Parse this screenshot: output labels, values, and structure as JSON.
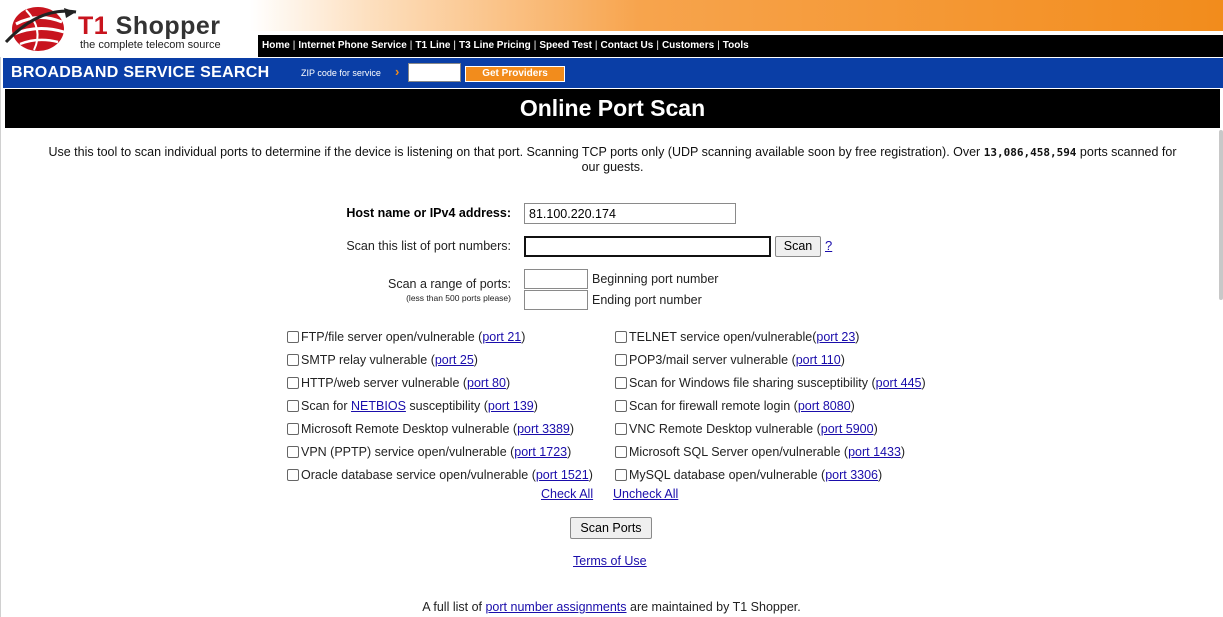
{
  "brand": {
    "name_prefix": "T1",
    "name_suffix": "Shopper",
    "tagline": "the complete telecom source"
  },
  "nav": [
    "Home",
    "Internet Phone Service",
    "T1 Line",
    "T3 Line Pricing",
    "Speed Test",
    "Contact Us",
    "Customers",
    "Tools"
  ],
  "broadband": {
    "title": "BROADBAND SERVICE SEARCH",
    "zip_label": "ZIP code for service",
    "arrow": "›",
    "zip_value": "",
    "button": "Get Providers"
  },
  "page_title": "Online Port Scan",
  "intro": {
    "text_before": "Use this tool to scan individual ports to determine if the device is listening on that port.  Scanning TCP ports only (UDP scanning available soon by free registration).  Over",
    "count": "13,086,458,594",
    "text_after": "ports scanned for our guests."
  },
  "form": {
    "host_label": "Host name or IPv4 address:",
    "host_value": "81.100.220.174",
    "list_label": "Scan this list of port numbers:",
    "list_value": "",
    "scan_button": "Scan",
    "help_link": "?",
    "range_label": "Scan a range of ports:",
    "range_note": "(less than 500 ports please)",
    "begin_value": "",
    "begin_label": "Beginning port number",
    "end_value": "",
    "end_label": "Ending port number"
  },
  "checks_left": [
    {
      "pre": "",
      "mid_link": "",
      "text": "FTP/file server open/vulnerable (",
      "port": "port 21",
      "post": ")"
    },
    {
      "pre": "",
      "mid_link": "",
      "text": "SMTP relay vulnerable (",
      "port": "port 25",
      "post": ")"
    },
    {
      "pre": "",
      "mid_link": "",
      "text": "HTTP/web server vulnerable (",
      "port": "port 80",
      "post": ")"
    },
    {
      "pre": "Scan for ",
      "mid_link": "NETBIOS",
      "text": " susceptibility (",
      "port": "port 139",
      "post": ")"
    },
    {
      "pre": "",
      "mid_link": "",
      "text": "Microsoft Remote Desktop vulnerable (",
      "port": "port 3389",
      "post": ")"
    },
    {
      "pre": "",
      "mid_link": "",
      "text": "VPN (PPTP) service open/vulnerable (",
      "port": "port 1723",
      "post": ")"
    },
    {
      "pre": "",
      "mid_link": "",
      "text": "Oracle database service open/vulnerable (",
      "port": "port 1521",
      "post": ")"
    }
  ],
  "checks_right": [
    {
      "text": "TELNET service open/vulnerable(",
      "port": "port 23",
      "post": ")"
    },
    {
      "text": "POP3/mail server vulnerable (",
      "port": "port 110",
      "post": ")"
    },
    {
      "text": "Scan for Windows file sharing susceptibility (",
      "port": "port 445",
      "post": ")"
    },
    {
      "text": "Scan for firewall remote login (",
      "port": "port 8080",
      "post": ")"
    },
    {
      "text": "VNC Remote Desktop vulnerable (",
      "port": "port 5900",
      "post": ")"
    },
    {
      "text": "Microsoft SQL Server open/vulnerable (",
      "port": "port 1433",
      "post": ")"
    },
    {
      "text": "MySQL database open/vulnerable (",
      "port": "port 3306",
      "post": ")"
    }
  ],
  "check_all": "Check All",
  "uncheck_all": "Uncheck All",
  "scan_ports_button": "Scan Ports",
  "terms_link": "Terms of Use",
  "footer": {
    "before": "A full list of ",
    "link": "port number assignments",
    "after": " are maintained by T1 Shopper."
  }
}
